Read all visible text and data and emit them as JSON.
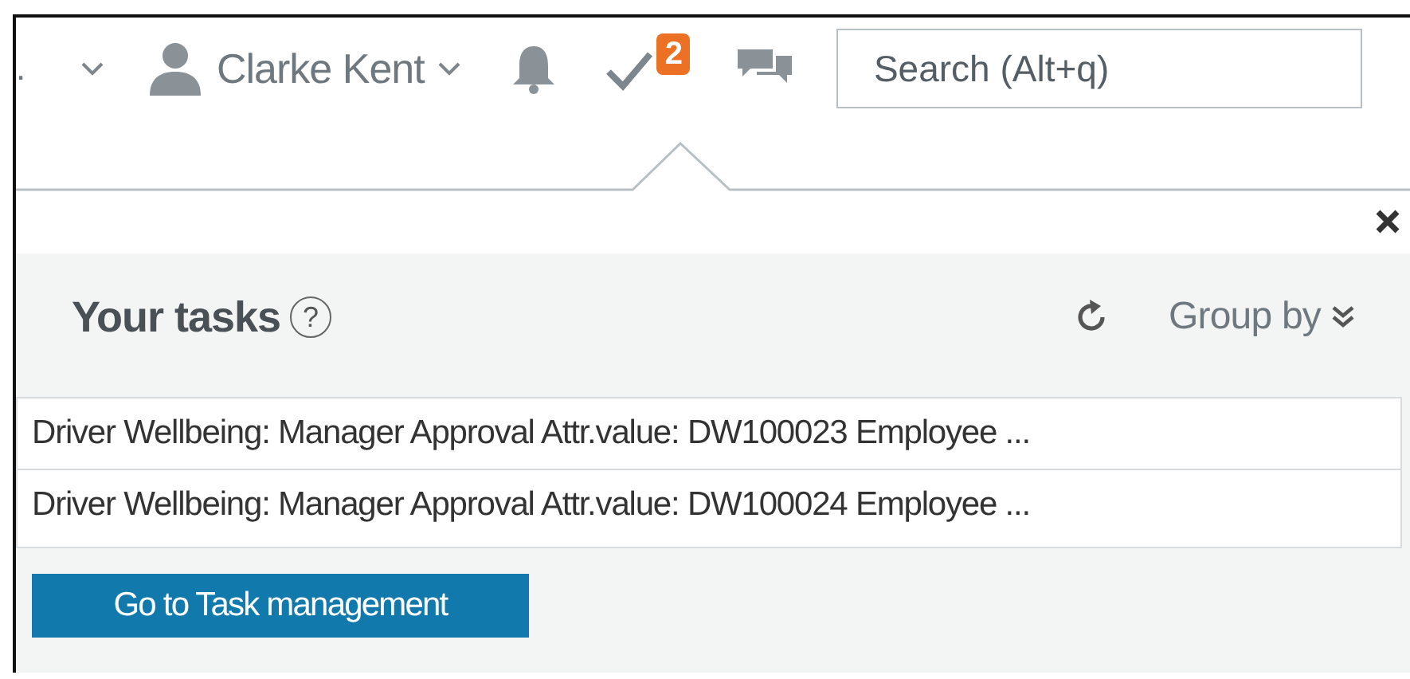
{
  "top_bar": {
    "cut_text": ".",
    "user": {
      "name": "Clarke Kent"
    },
    "tasks_badge": "2",
    "search": {
      "placeholder": "Search (Alt+q)"
    }
  },
  "tasks_panel": {
    "title": "Your tasks",
    "help": "?",
    "group_by": "Group by",
    "tasks": [
      {
        "label": "Driver Wellbeing: Manager Approval Attr.value: DW100023 Employee ..."
      },
      {
        "label": "Driver Wellbeing: Manager Approval Attr.value: DW100024 Employee ..."
      }
    ],
    "button": "Go to Task management"
  }
}
